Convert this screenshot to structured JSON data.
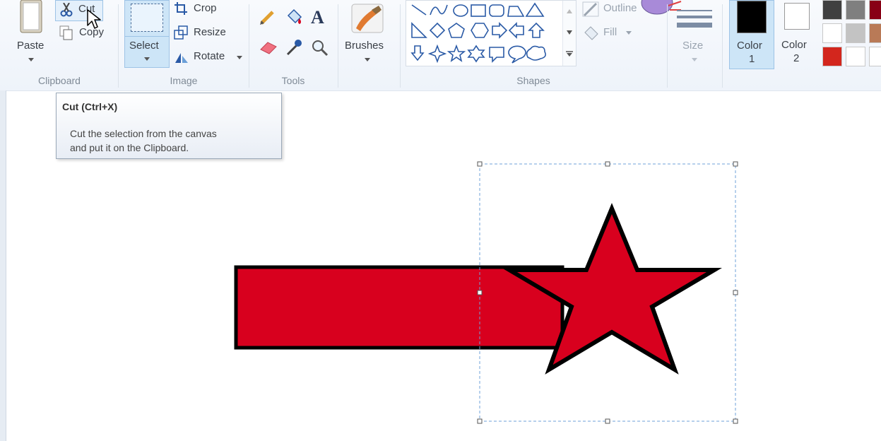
{
  "clipboard": {
    "paste_label": "Paste",
    "cut_label": "Cut",
    "copy_label": "Copy",
    "group_label": "Clipboard"
  },
  "image": {
    "select_label": "Select",
    "crop_label": "Crop",
    "resize_label": "Resize",
    "rotate_label": "Rotate",
    "group_label": "Image"
  },
  "tools": {
    "group_label": "Tools",
    "items": [
      "pencil-icon",
      "fill-bucket-icon",
      "text-icon",
      "eraser-icon",
      "color-picker-icon",
      "magnifier-icon"
    ]
  },
  "brushes": {
    "label": "Brushes"
  },
  "shapes": {
    "group_label": "Shapes",
    "outline_label": "Outline",
    "fill_label": "Fill"
  },
  "size": {
    "label": "Size"
  },
  "colors": {
    "color1_label": "Color",
    "color1_num": "1",
    "color2_label": "Color",
    "color2_num": "2",
    "color1_value": "#000000",
    "color2_value": "#ffffff",
    "palette": [
      "#404040",
      "#7f7f7f",
      "#880015",
      "#ffffff",
      "#c3c3c3",
      "#b97a57",
      "#d3261d",
      "#ffffff",
      "#ffffff"
    ]
  },
  "tooltip": {
    "title": "Cut (Ctrl+X)",
    "line1": "Cut the selection from the canvas",
    "line2": "and put it on the Clipboard."
  },
  "canvas": {
    "shape_fill": "#d8001e",
    "shape_stroke": "#000000",
    "selection_color": "#5b9bd5"
  }
}
